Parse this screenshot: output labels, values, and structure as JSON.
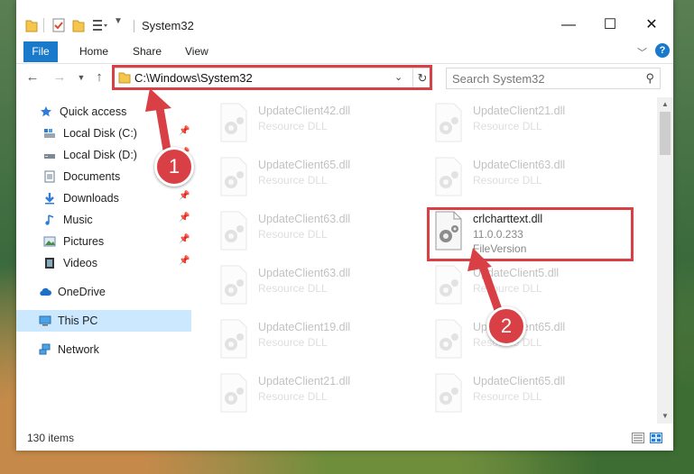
{
  "window": {
    "title": "System32",
    "controls": {
      "minimize": "—",
      "maximize": "☐",
      "close": "✕"
    }
  },
  "ribbon": {
    "tabs": [
      "File",
      "Home",
      "Share",
      "View"
    ],
    "help": "?"
  },
  "address_bar": {
    "path": "C:\\Windows\\System32"
  },
  "search": {
    "placeholder": "Search System32"
  },
  "nav_pane": {
    "items": [
      {
        "label": "Quick access",
        "icon": "star-icon",
        "pinned": false
      },
      {
        "label": "Local Disk (C:)",
        "icon": "drive-icon",
        "pinned": true
      },
      {
        "label": "Local Disk (D:)",
        "icon": "drive-icon",
        "pinned": true
      },
      {
        "label": "Documents",
        "icon": "documents-icon",
        "pinned": true
      },
      {
        "label": "Downloads",
        "icon": "download-icon",
        "pinned": true
      },
      {
        "label": "Music",
        "icon": "music-icon",
        "pinned": true
      },
      {
        "label": "Pictures",
        "icon": "pictures-icon",
        "pinned": true
      },
      {
        "label": "Videos",
        "icon": "videos-icon",
        "pinned": true
      },
      {
        "label": "OneDrive",
        "icon": "cloud-icon",
        "pinned": false
      },
      {
        "label": "This PC",
        "icon": "computer-icon",
        "pinned": false,
        "selected": true
      },
      {
        "label": "Network",
        "icon": "network-icon",
        "pinned": false
      }
    ]
  },
  "files": {
    "left": [
      {
        "name": "UpdateClient42.dll",
        "type": "Resource DLL"
      },
      {
        "name": "UpdateClient65.dll",
        "type": "Resource DLL"
      },
      {
        "name": "UpdateClient63.dll",
        "type": "Resource DLL"
      },
      {
        "name": "UpdateClient63.dll",
        "type": "Resource DLL"
      },
      {
        "name": "UpdateClient19.dll",
        "type": "Resource DLL"
      },
      {
        "name": "UpdateClient21.dll",
        "type": "Resource DLL"
      }
    ],
    "right": [
      {
        "name": "UpdateClient21.dll",
        "type": "Resource DLL"
      },
      {
        "name": "UpdateClient63.dll",
        "type": "Resource DLL"
      },
      {
        "name": "crlcharttext.dll",
        "version": "11.0.0.233",
        "type": "FileVersion",
        "highlight": true
      },
      {
        "name": "UpdateClient5.dll",
        "type": "Resource DLL"
      },
      {
        "name": "UpdateClient65.dll",
        "type": "Resource DLL"
      },
      {
        "name": "UpdateClient65.dll",
        "type": "Resource DLL"
      }
    ]
  },
  "status_bar": {
    "item_count": "130 items"
  },
  "callouts": [
    {
      "number": "1"
    },
    {
      "number": "2"
    }
  ],
  "colors": {
    "accent": "#1979ca",
    "highlight": "#d94045",
    "selected": "#cce8ff"
  }
}
